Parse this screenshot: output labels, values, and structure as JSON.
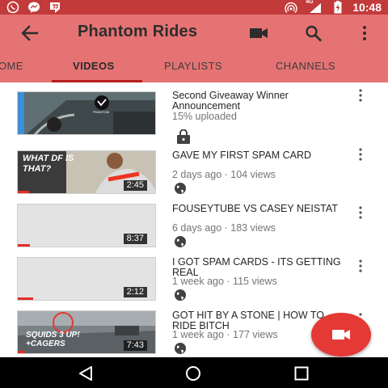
{
  "status_bar": {
    "time": "10:48",
    "network": "4G",
    "left_icons": [
      "whatsapp-icon",
      "messenger-icon",
      "hangouts-icon"
    ],
    "right_icons": [
      "hotspot-icon",
      "signal-icon",
      "battery-charging-icon"
    ]
  },
  "app_bar": {
    "title": "Phantom Rides",
    "actions": [
      "video-camera-icon",
      "search-icon",
      "more-vert-icon"
    ]
  },
  "tabs": [
    {
      "label": "OME",
      "active": false
    },
    {
      "label": "VIDEOS",
      "active": true
    },
    {
      "label": "PLAYLISTS",
      "active": false
    },
    {
      "label": "CHANNELS",
      "active": false
    }
  ],
  "videos": [
    {
      "title": "Second Giveaway Winner Announcement",
      "meta": "15% uploaded",
      "duration": "",
      "privacy_icon": "lock-icon",
      "thumb_text": "PHANTOM"
    },
    {
      "title": "GAVE MY FIRST SPAM CARD",
      "meta": "2 days ago · 104 views",
      "duration": "2:45",
      "privacy_icon": "globe-icon",
      "thumb_text": "WHAT DF IS THAT?"
    },
    {
      "title": "FOUSEYTUBE VS CASEY NEISTAT",
      "meta": "6 days ago · 183 views",
      "duration": "8:37",
      "privacy_icon": "globe-icon",
      "thumb_text": ""
    },
    {
      "title": "I GOT SPAM CARDS - ITS GETTING REAL",
      "meta": "1 week ago · 115 views",
      "duration": "2:12",
      "privacy_icon": "globe-icon",
      "thumb_text": ""
    },
    {
      "title": "GOT HIT BY A STONE | HOW TO RIDE BITCH",
      "meta": "1 week ago · 177 views",
      "duration": "7:43",
      "privacy_icon": "globe-icon",
      "thumb_text": "SQUIDS 3 UP! +CAGERS"
    }
  ],
  "fab": {
    "icon": "video-camera-icon"
  },
  "nav_bar": [
    "back-triangle-icon",
    "home-circle-icon",
    "recents-square-icon"
  ],
  "colors": {
    "status_bar": "#c23a3a",
    "app_bar": "#e57373",
    "accent": "#e53935",
    "tab_indicator": "#b71c1c"
  }
}
